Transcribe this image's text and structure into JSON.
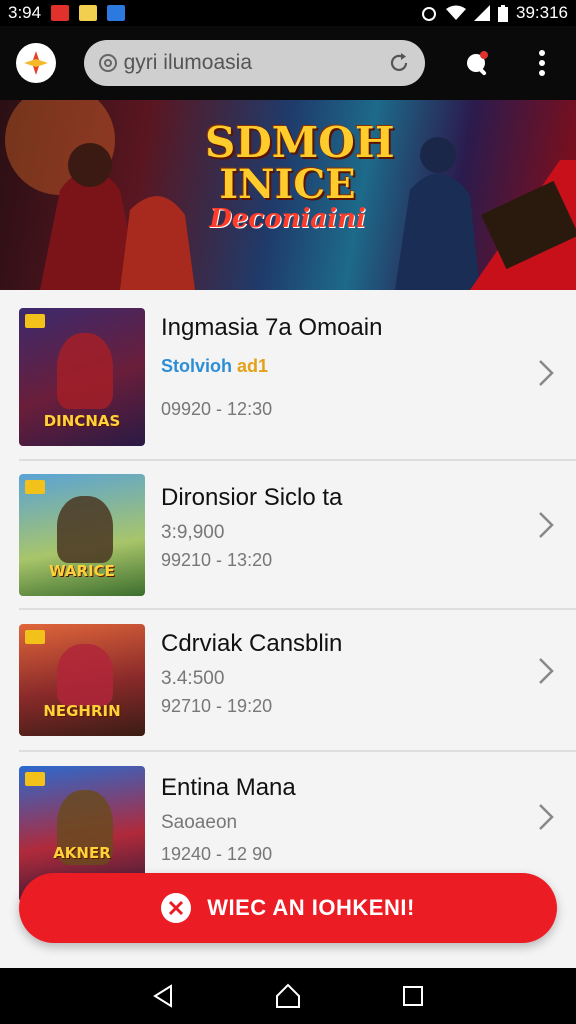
{
  "status_bar": {
    "left_time": "3:94",
    "right_time": "39:316",
    "icons": [
      "app-notification-icon",
      "note-notification-icon",
      "shield-notification-icon",
      "alarm-icon",
      "wifi-icon",
      "signal-icon",
      "battery-icon"
    ]
  },
  "app_bar": {
    "search_text": "gyri ilumoasia",
    "actions": [
      "refresh-icon",
      "notification-bell-icon",
      "more-vert-icon"
    ]
  },
  "banner": {
    "title_line1": "SDMOH",
    "title_line2": "INICE",
    "title_line3": "Deconiaini"
  },
  "items": [
    {
      "title": "Ingmasia 7a Omoain",
      "sub_a": "Stolvioh",
      "sub_b": "ad1",
      "time": "09920 - 12:30",
      "caption": "DINCNAS"
    },
    {
      "title": "Dironsior Siclo ta",
      "sub": "3:9,900",
      "time": "99210 - 13:20",
      "caption": "WARICE"
    },
    {
      "title": "Cdrviak Cansblin",
      "sub": "3.4:500",
      "time": "92710 - 19:20",
      "caption": "NEGHRIN"
    },
    {
      "title": "Entina Mana",
      "sub": "Saoaeon",
      "time": "19240 - 12 90",
      "caption": "AKNER"
    }
  ],
  "cta": {
    "label": "WIEC AN IOHKENI!"
  },
  "colors": {
    "accent": "#ec1c24",
    "link": "#2c8ed6",
    "gold": "#ffcc2e"
  }
}
